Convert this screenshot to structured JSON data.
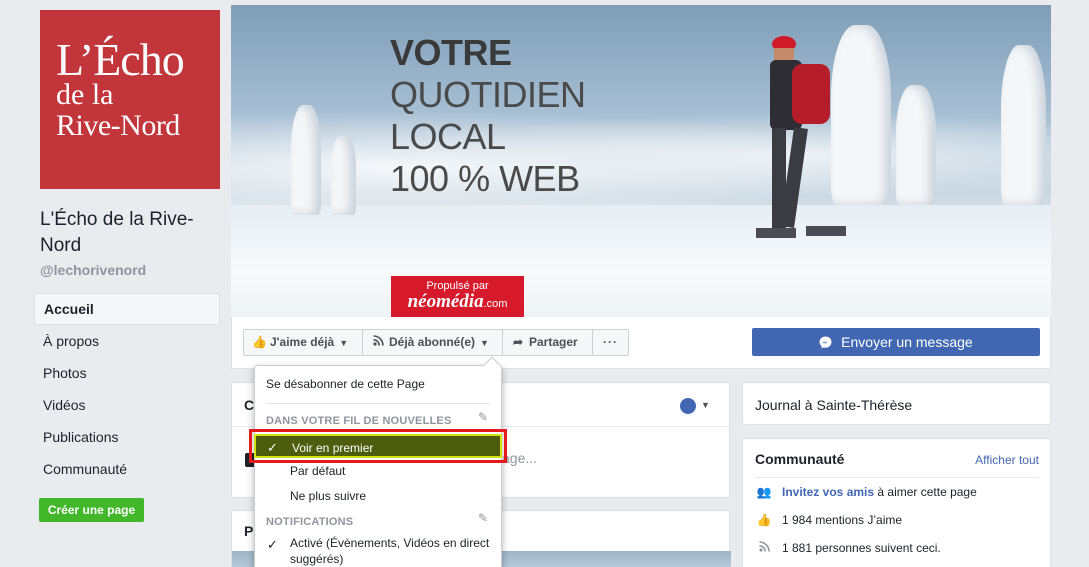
{
  "sidebar": {
    "logo": {
      "line1": "L’Écho",
      "line2": "de la",
      "line3": "Rive-Nord",
      "color": "#c1353b"
    },
    "page_name": "L'Écho de la Rive-Nord",
    "handle": "@lechorivenord",
    "nav": [
      {
        "label": "Accueil",
        "active": true
      },
      {
        "label": "À propos"
      },
      {
        "label": "Photos"
      },
      {
        "label": "Vidéos"
      },
      {
        "label": "Publications"
      },
      {
        "label": "Communauté"
      }
    ],
    "create_page": "Créer une page"
  },
  "cover": {
    "line1": "VOTRE",
    "line2": "QUOTIDIEN",
    "line3": "LOCAL",
    "line4": "100 % WEB",
    "powered_by": "Propulsé par",
    "brand": "néomédia",
    "brand_suffix": ".com"
  },
  "actions": {
    "like": "J'aime déjà",
    "follow": "Déjà abonné(e)",
    "share": "Partager",
    "more": "···",
    "message": "Envoyer un message"
  },
  "composer": {
    "header_letter": "C",
    "placeholder": "age..."
  },
  "photos_card": {
    "title": "P"
  },
  "right": {
    "location": "Journal à Sainte-Thérèse",
    "community": {
      "title": "Communauté",
      "see_all": "Afficher tout",
      "invite_link": "Invitez vos amis",
      "invite_rest": " à aimer cette page",
      "likes": "1 984 mentions J’aime",
      "followers": "1 881 personnes suivent ceci."
    }
  },
  "dropdown": {
    "unsubscribe": "Se désabonner de cette Page",
    "news_feed_header": "DANS VOTRE FIL DE NOUVELLES",
    "see_first": "Voir en premier",
    "default": "Par défaut",
    "unfollow": "Ne plus suivre",
    "notifications_header": "NOTIFICATIONS",
    "active": "Activé (Évènements, Vidéos en direct suggérés)"
  },
  "colors": {
    "fb_blue": "#4267b2",
    "create_green": "#42b72a",
    "highlight_bg": "#4e5c0e",
    "highlight_border": "#e31b1b"
  }
}
